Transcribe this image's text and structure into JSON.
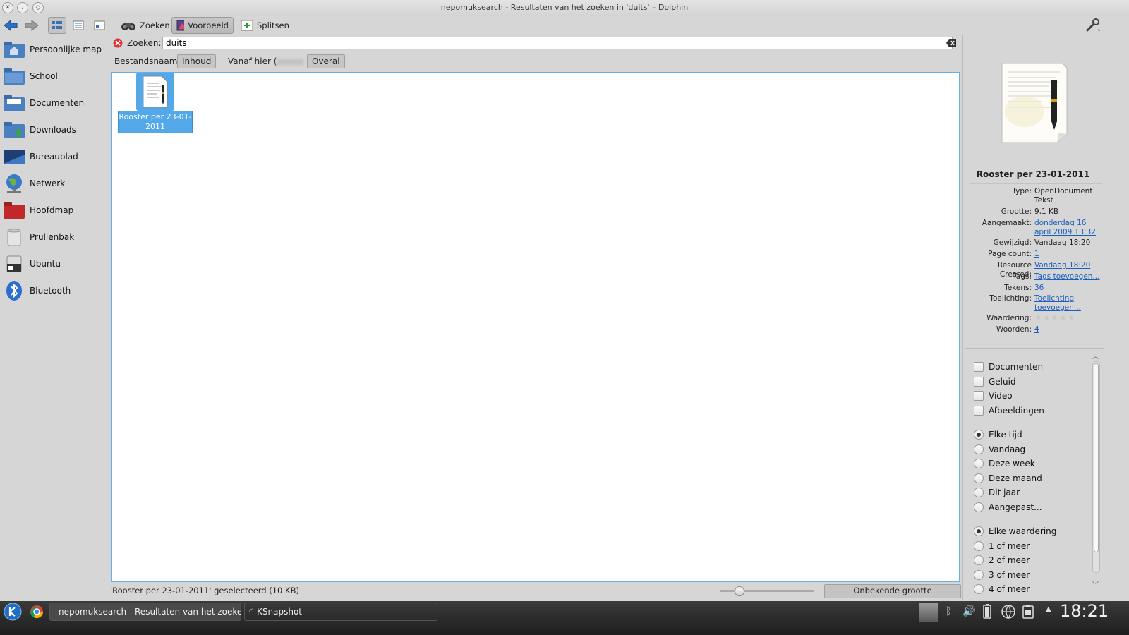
{
  "window": {
    "title": "nepomuksearch - Resultaten van het zoeken in 'duits' – Dolphin"
  },
  "toolbar": {
    "search_label": "Zoeken",
    "preview_label": "Voorbeeld",
    "split_label": "Splitsen"
  },
  "places": [
    {
      "label": "Persoonlijke map",
      "icon": "home-folder-icon"
    },
    {
      "label": "School",
      "icon": "folder-icon"
    },
    {
      "label": "Documenten",
      "icon": "documents-folder-icon"
    },
    {
      "label": "Downloads",
      "icon": "downloads-folder-icon"
    },
    {
      "label": "Bureaublad",
      "icon": "desktop-icon"
    },
    {
      "label": "Netwerk",
      "icon": "network-globe-icon"
    },
    {
      "label": "Hoofdmap",
      "icon": "root-folder-icon"
    },
    {
      "label": "Prullenbak",
      "icon": "trash-icon"
    },
    {
      "label": "Ubuntu",
      "icon": "drive-icon"
    },
    {
      "label": "Bluetooth",
      "icon": "bluetooth-icon"
    }
  ],
  "search": {
    "label": "Zoeken:",
    "value": "duits"
  },
  "filters": {
    "filename": "Bestandsnaam",
    "content": "Inhoud",
    "from_here": "Vanaf hier (",
    "everywhere": "Overal"
  },
  "file": {
    "name": "Rooster per 23-01-2011"
  },
  "status": {
    "text": "'Rooster per 23-01-2011' geselecteerd (10 KB)",
    "size_button": "Onbekende grootte",
    "zoom_level": 0.2
  },
  "info": {
    "title": "Rooster per 23-01-2011",
    "rows": [
      {
        "key": "Type:",
        "value": "OpenDocument Tekst",
        "link": false
      },
      {
        "key": "Grootte:",
        "value": "9,1 KB",
        "link": false
      },
      {
        "key": "Aangemaakt:",
        "value": "donderdag 16 april 2009 13:32",
        "link": true
      },
      {
        "key": "Gewijzigd:",
        "value": "Vandaag 18:20",
        "link": false
      },
      {
        "key": "Page count:",
        "value": "1",
        "link": true
      },
      {
        "key": "Resource Created:",
        "value": "Vandaag 18:20",
        "link": true
      },
      {
        "key": "Tags:",
        "value": "Tags toevoegen...",
        "link": true
      },
      {
        "key": "Tekens:",
        "value": "36",
        "link": true
      },
      {
        "key": "Toelichting:",
        "value": "Toelichting toevoegen...",
        "link": true
      },
      {
        "key": "Waardering:",
        "value": "",
        "link": false
      },
      {
        "key": "Woorden:",
        "value": "4",
        "link": true
      }
    ],
    "rating": 0
  },
  "filter_panel": {
    "types": [
      "Documenten",
      "Geluid",
      "Video",
      "Afbeeldingen"
    ],
    "times": [
      "Elke tijd",
      "Vandaag",
      "Deze week",
      "Deze maand",
      "Dit jaar",
      "Aangepast..."
    ],
    "ratings": [
      "Elke waardering",
      "1 of meer",
      "2 of meer",
      "3 of meer",
      "4 of meer"
    ]
  },
  "taskbar": {
    "task1": "nepomuksearch - Resultaten van het zoeken",
    "task2": "KSnapshot",
    "clock": "18:21"
  }
}
